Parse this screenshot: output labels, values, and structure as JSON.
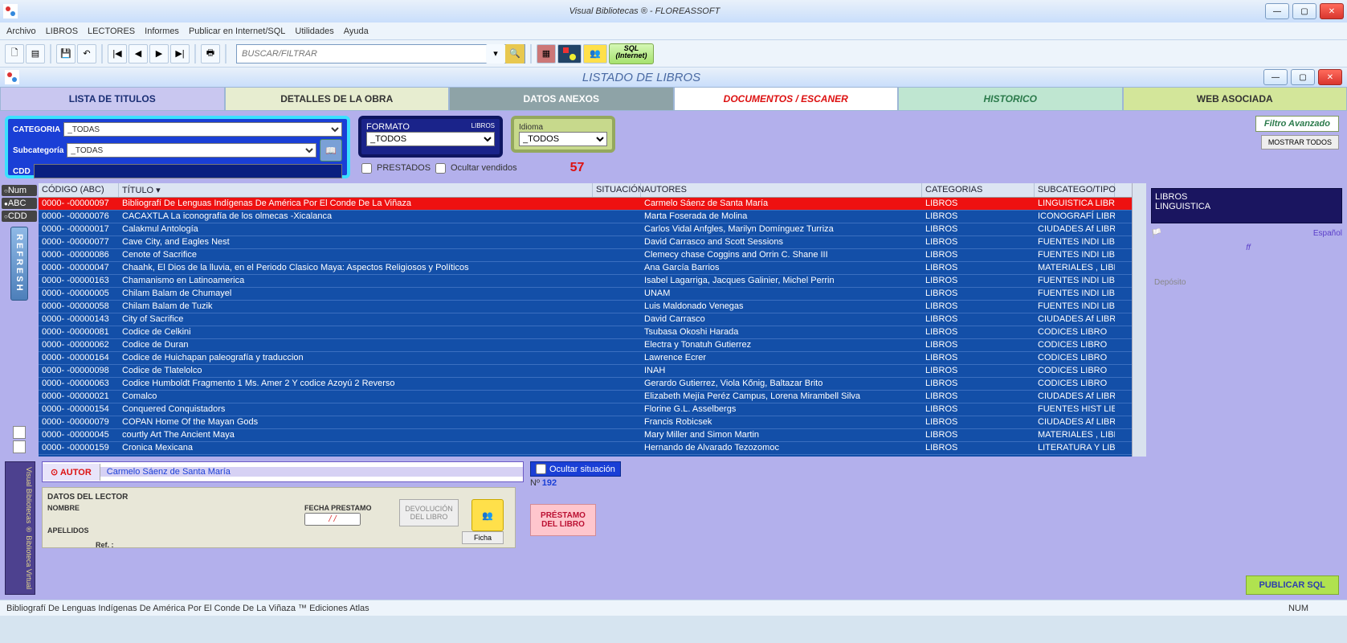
{
  "app": {
    "title": "Visual Bibliotecas ®  - FLOREASSOFT"
  },
  "menu": [
    "Archivo",
    "LIBROS",
    "LECTORES",
    "Informes",
    "Publicar en Internet/SQL",
    "Utilidades",
    "Ayuda"
  ],
  "toolbar": {
    "search_placeholder": "BUSCAR/FILTRAR",
    "sql_label": "SQL\n(Internet)"
  },
  "subwindow": {
    "title": "LISTADO DE LIBROS"
  },
  "tabs": [
    "LISTA DE TITULOS",
    "DETALLES DE LA OBRA",
    "DATOS ANEXOS",
    "DOCUMENTOS / ESCANER",
    "HISTORICO",
    "WEB ASOCIADA"
  ],
  "filters": {
    "categoria_label": "CATEGORIA",
    "categoria_value": "_TODAS",
    "subcat_label": "Subcategoría",
    "subcat_value": "_TODAS",
    "cdd_label": "CDD",
    "formato_label": "FORMATO",
    "formato_right": "LIBROS",
    "formato_value": "_TODOS",
    "idioma_label": "Idioma",
    "idioma_value": "_TODOS",
    "prestados": "PRESTADOS",
    "ocultar": "Ocultar vendidos",
    "count": "57",
    "filtro_avanzado": "Filtro Avanzado",
    "mostrar_todos": "MOSTRAR TODOS"
  },
  "sort_opts": [
    "Num",
    "ABC",
    "CDD"
  ],
  "refresh": "REFRESH",
  "columns": {
    "codigo": "CÓDIGO (ABC)",
    "titulo": "TÍTULO ▾",
    "situacion": "SITUACIÓN",
    "autores": "AUTORES",
    "categorias": "CATEGORIAS",
    "subcat": "SUBCATEGO/TIPO"
  },
  "rows": [
    {
      "code": "0000-  -00000097",
      "title": "Bibliografí De Lenguas Indígenas De América Por El Conde De La Viñaza",
      "aut": "Carmelo Sáenz de Santa María",
      "cat": "LIBROS",
      "sub": "LINGUISTICA  LIBRO",
      "sel": true
    },
    {
      "code": "0000-  -00000076",
      "title": "CACAXTLA La iconografía de los olmecas -Xicalanca",
      "aut": "Marta Foserada de Molina",
      "cat": "LIBROS",
      "sub": "ICONOGRAFÍ LIBRO"
    },
    {
      "code": "0000-  -00000017",
      "title": "Calakmul Antología",
      "aut": "Carlos Vidal Anfgles, Marilyn Domínguez Turriza",
      "cat": "LIBROS",
      "sub": "CIUDADES Af LIBRO"
    },
    {
      "code": "0000-  -00000077",
      "title": "Cave City, and Eagles Nest",
      "aut": "David Carrasco and Scott Sessions",
      "cat": "LIBROS",
      "sub": "FUENTES INDI LIBRO"
    },
    {
      "code": "0000-  -00000086",
      "title": "Cenote of Sacrifice",
      "aut": "Clemecy chase Coggins and Orrin C. Shane III",
      "cat": "LIBROS",
      "sub": "FUENTES INDI LIBRO"
    },
    {
      "code": "0000-  -00000047",
      "title": "Chaahk, El Dios de la lluvia, en el Periodo Clasico Maya: Aspectos Religiosos y Políticos",
      "aut": "Ana García Barrios",
      "cat": "LIBROS",
      "sub": "MATERIALES , LIBRO"
    },
    {
      "code": "0000-  -00000163",
      "title": "Chamanismo en Latinoamerica",
      "aut": "Isabel Lagarriga, Jacques Galinier, Michel Perrin",
      "cat": "LIBROS",
      "sub": "FUENTES INDI LIBRO"
    },
    {
      "code": "0000-  -00000005",
      "title": "Chilam Balam de Chumayel",
      "aut": "UNAM",
      "cat": "LIBROS",
      "sub": "FUENTES INDI LIBRO"
    },
    {
      "code": "0000-  -00000058",
      "title": "Chilam Balam de Tuzik",
      "aut": "Luis Maldonado Venegas",
      "cat": "LIBROS",
      "sub": "FUENTES INDI LIBRO"
    },
    {
      "code": "0000-  -00000143",
      "title": "City of Sacrifice",
      "aut": "David Carrasco",
      "cat": "LIBROS",
      "sub": "CIUDADES Af LIBRO"
    },
    {
      "code": "0000-  -00000081",
      "title": "Codice de Celkini",
      "aut": "Tsubasa Okoshi Harada",
      "cat": "LIBROS",
      "sub": "CODICES      LIBRO"
    },
    {
      "code": "0000-  -00000062",
      "title": "Codice de Duran",
      "aut": "Electra y Tonatuh Gutierrez",
      "cat": "LIBROS",
      "sub": "CODICES      LIBRO"
    },
    {
      "code": "0000-  -00000164",
      "title": "Codice de Huichapan paleografía y traduccion",
      "aut": "Lawrence Ecrer",
      "cat": "LIBROS",
      "sub": "CODICES      LIBRO"
    },
    {
      "code": "0000-  -00000098",
      "title": "Codice de Tlatelolco",
      "aut": "INAH",
      "cat": "LIBROS",
      "sub": "CODICES      LIBRO"
    },
    {
      "code": "0000-  -00000063",
      "title": "Codice Humboldt Fragmento 1 Ms. Amer 2 Y codice Azoyú 2 Reverso",
      "aut": "Gerardo Gutierrez, Viola Kőnig, Baltazar Brito",
      "cat": "LIBROS",
      "sub": "CODICES      LIBRO"
    },
    {
      "code": "0000-  -00000021",
      "title": "Comalco",
      "aut": "Elizabeth Mejía Peréz Campus, Lorena Mirambell Silva",
      "cat": "LIBROS",
      "sub": "CIUDADES Af LIBRO"
    },
    {
      "code": "0000-  -00000154",
      "title": "Conquered Conquistadors",
      "aut": "Florine G.L. Asselbergs",
      "cat": "LIBROS",
      "sub": "FUENTES HIST LIBRO"
    },
    {
      "code": "0000-  -00000079",
      "title": "COPAN Home Of the Mayan Gods",
      "aut": "Francis Robicsek",
      "cat": "LIBROS",
      "sub": "CIUDADES Af LIBRO"
    },
    {
      "code": "0000-  -00000045",
      "title": "courtly Art The Ancient Maya",
      "aut": "Mary Miller and Simon Martin",
      "cat": "LIBROS",
      "sub": "MATERIALES , LIBRO"
    },
    {
      "code": "0000-  -00000159",
      "title": "Cronica Mexicana",
      "aut": "Hernando de Alvarado Tezozomoc",
      "cat": "LIBROS",
      "sub": "LITERATURA Y LIBRO"
    }
  ],
  "rightpanel": {
    "libros": "LIBROS",
    "ling": "LINGUISTICA",
    "idioma": "Español",
    "ff": "ff",
    "deposito": "Depósito"
  },
  "author": {
    "label": "⊙ AUTOR",
    "value": "Carmelo Sáenz de Santa María"
  },
  "ocultar_sit": "Ocultar situación",
  "n_label": "Nº",
  "n_value": "192",
  "loan": {
    "header": "DATOS DEL LECTOR",
    "nombre": "NOMBRE",
    "apellidos": "APELLIDOS",
    "ref": "Ref. :",
    "fecha": "FECHA PRESTAMO",
    "fecha_val": "/ /",
    "dev": "DEVOLUCIÓN DEL LIBRO",
    "ficha": "Ficha",
    "prestamo": "PRÉSTAMO DEL LIBRO"
  },
  "publicar": "PUBLICAR SQL",
  "tabstrip": "Visual Bibliotecas ® Biblioteca Virtual",
  "status": {
    "text": "Bibliografí De Lenguas Indígenas De América Por El Conde De La Viñaza ™ Ediciones Atlas",
    "num": "NUM"
  }
}
